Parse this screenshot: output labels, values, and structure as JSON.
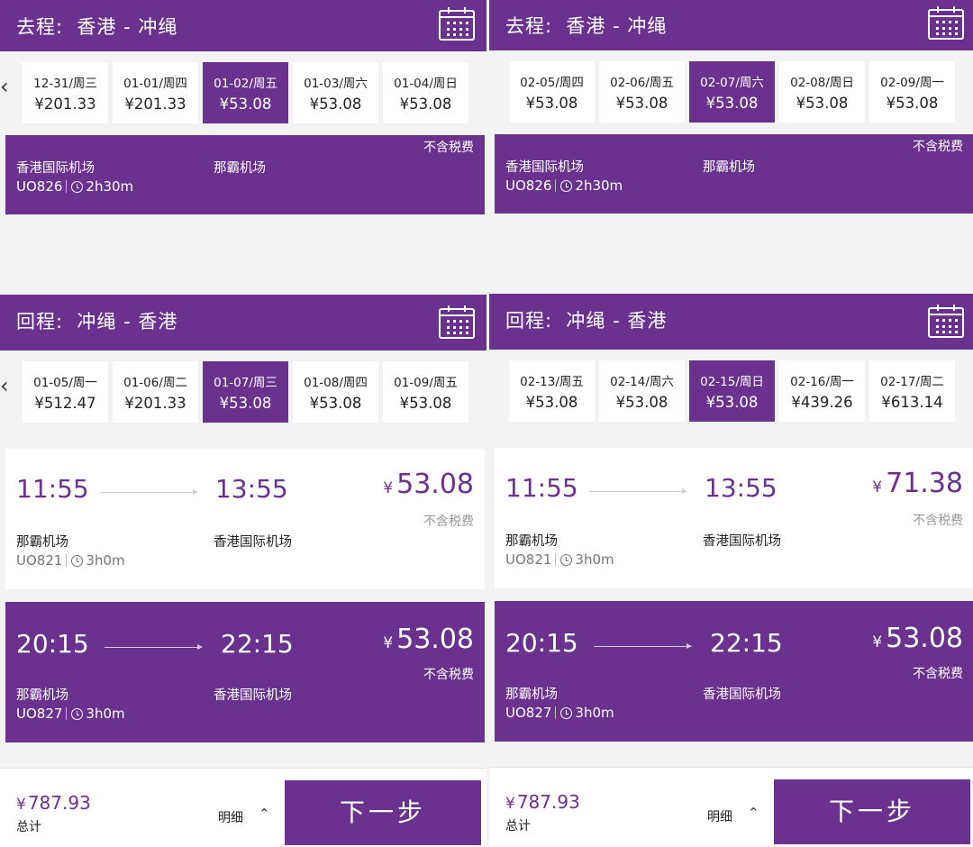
{
  "colors": {
    "brand": "#6a318f",
    "background": "#f3f3f4"
  },
  "icons": {
    "calendar": "calendar-icon",
    "prev": "chevron-left-icon",
    "next": "chevron-right-icon",
    "clock": "clock-icon",
    "detail": "chevron-up-icon"
  },
  "panels": [
    {
      "outbound": {
        "title": "去程:  香港 - 冲绳",
        "dates": [
          {
            "date": "12-31/周三",
            "price": "¥201.33"
          },
          {
            "date": "01-01/周四",
            "price": "¥201.33"
          },
          {
            "date": "01-02/周五",
            "price": "¥53.08",
            "selected": true
          },
          {
            "date": "01-03/周六",
            "price": "¥53.08"
          },
          {
            "date": "01-04/周日",
            "price": "¥53.08"
          }
        ],
        "flight": {
          "tax_note": "不含税费",
          "from": "香港国际机场",
          "to": "那霸机场",
          "number": "UO826",
          "duration": "2h30m"
        }
      },
      "return": {
        "title": "回程:  冲绳 - 香港",
        "dates": [
          {
            "date": "01-05/周一",
            "price": "¥512.47"
          },
          {
            "date": "01-06/周二",
            "price": "¥201.33"
          },
          {
            "date": "01-07/周三",
            "price": "¥53.08",
            "selected": true
          },
          {
            "date": "01-08/周四",
            "price": "¥53.08"
          },
          {
            "date": "01-09/周五",
            "price": "¥53.08"
          }
        ],
        "flights": [
          {
            "dep": "11:55",
            "arr": "13:55",
            "currency": "¥",
            "price": "53.08",
            "tax_note": "不含税费",
            "from": "那霸机场",
            "to": "香港国际机场",
            "number": "UO821",
            "duration": "3h0m"
          },
          {
            "dep": "20:15",
            "arr": "22:15",
            "currency": "¥",
            "price": "53.08",
            "tax_note": "不含税费",
            "from": "那霸机场",
            "to": "香港国际机场",
            "number": "UO827",
            "duration": "3h0m"
          }
        ]
      },
      "footer": {
        "currency": "¥",
        "total": "787.93",
        "total_label": "总计",
        "detail": "明细",
        "next": "下一步"
      }
    },
    {
      "outbound": {
        "title": "去程:  香港 - 冲绳",
        "dates": [
          {
            "date": "02-05/周四",
            "price": "¥53.08"
          },
          {
            "date": "02-06/周五",
            "price": "¥53.08"
          },
          {
            "date": "02-07/周六",
            "price": "¥53.08",
            "selected": true
          },
          {
            "date": "02-08/周日",
            "price": "¥53.08"
          },
          {
            "date": "02-09/周一",
            "price": "¥53.08"
          }
        ],
        "flight": {
          "tax_note": "不含税费",
          "from": "香港国际机场",
          "to": "那霸机场",
          "number": "UO826",
          "duration": "2h30m"
        }
      },
      "return": {
        "title": "回程:  冲绳 - 香港",
        "dates": [
          {
            "date": "02-13/周五",
            "price": "¥53.08"
          },
          {
            "date": "02-14/周六",
            "price": "¥53.08"
          },
          {
            "date": "02-15/周日",
            "price": "¥53.08",
            "selected": true
          },
          {
            "date": "02-16/周一",
            "price": "¥439.26"
          },
          {
            "date": "02-17/周二",
            "price": "¥613.14"
          }
        ],
        "flights": [
          {
            "dep": "11:55",
            "arr": "13:55",
            "currency": "¥",
            "price": "71.38",
            "tax_note": "不含税费",
            "from": "那霸机场",
            "to": "香港国际机场",
            "number": "UO821",
            "duration": "3h0m"
          },
          {
            "dep": "20:15",
            "arr": "22:15",
            "currency": "¥",
            "price": "53.08",
            "tax_note": "不含税费",
            "from": "那霸机场",
            "to": "香港国际机场",
            "number": "UO827",
            "duration": "3h0m"
          }
        ]
      },
      "footer": {
        "currency": "¥",
        "total": "787.93",
        "total_label": "总计",
        "detail": "明细",
        "next": "下一步"
      }
    }
  ]
}
